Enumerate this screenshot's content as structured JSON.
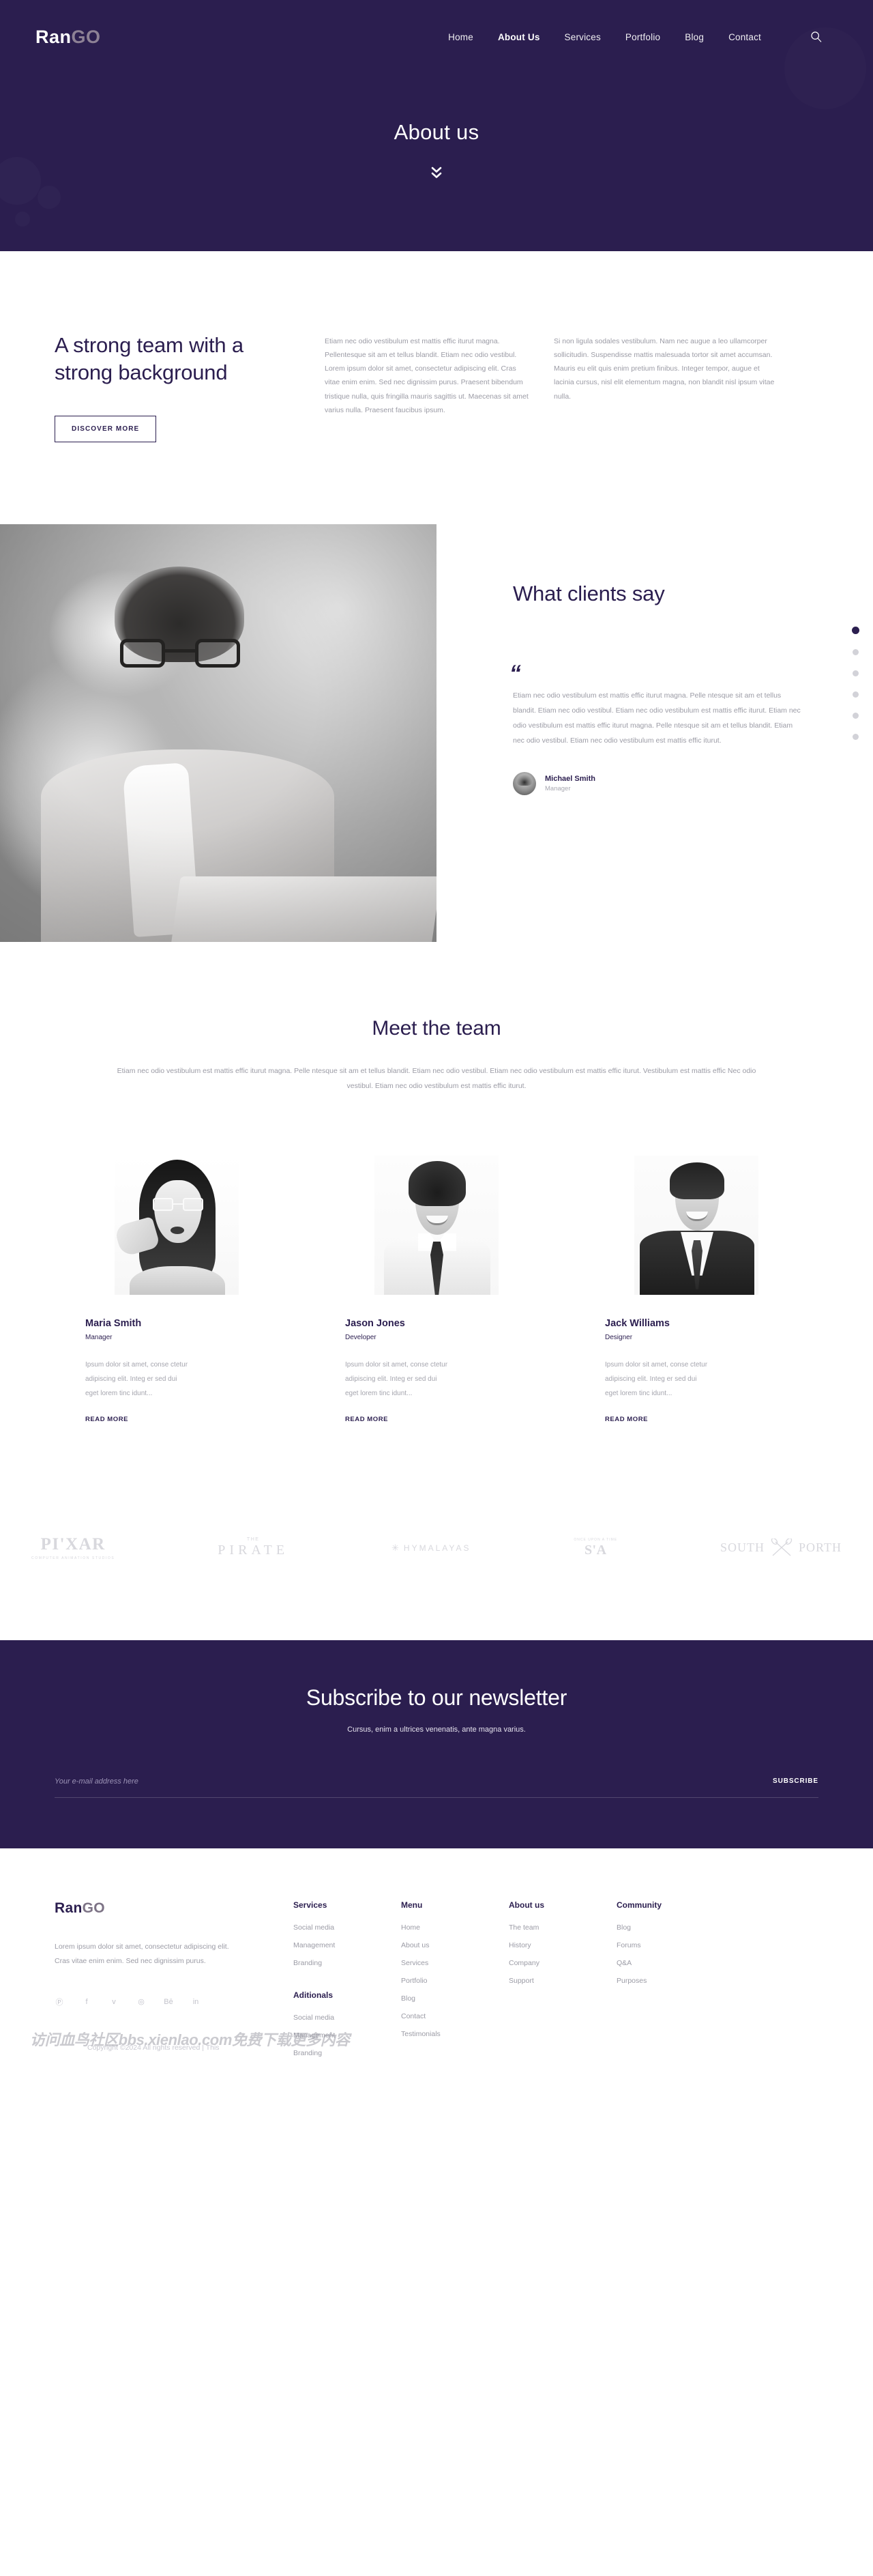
{
  "brand": {
    "part1": "Ran",
    "part2": "GO"
  },
  "nav": {
    "items": [
      {
        "label": "Home",
        "active": false
      },
      {
        "label": "About Us",
        "active": true
      },
      {
        "label": "Services",
        "active": false
      },
      {
        "label": "Portfolio",
        "active": false
      },
      {
        "label": "Blog",
        "active": false
      },
      {
        "label": "Contact",
        "active": false
      }
    ],
    "search_icon": "search-icon"
  },
  "hero": {
    "title": "About us",
    "scroll_icon": "chevron-double-down-icon"
  },
  "strong_team": {
    "heading": "A strong team with a strong background",
    "button": "DISCOVER MORE",
    "col1": "Etiam nec odio vestibulum est mattis effic iturut magna. Pellentesque sit am et tellus blandit. Etiam nec odio vestibul. Lorem ipsum dolor sit amet, consectetur adipiscing elit. Cras vitae enim enim. Sed nec dignissim purus. Praesent bibendum tristique nulla, quis fringilla mauris sagittis ut. Maecenas sit amet varius nulla. Praesent faucibus ipsum.",
    "col2": "Si non ligula sodales vestibulum. Nam nec augue a leo ullamcorper sollicitudin. Suspendisse mattis malesuada tortor sit amet accumsan. Mauris eu elit quis enim pretium finibus. Integer tempor, augue et lacinia cursus, nisl elit elementum magna, non blandit nisl ipsum vitae nulla."
  },
  "testimonials": {
    "title": "What clients say",
    "quote_mark": "”",
    "text": "Etiam nec odio vestibulum est mattis effic iturut magna. Pelle ntesque sit am et tellus blandit. Etiam nec odio vestibul. Etiam nec odio vestibulum est mattis effic iturut. Etiam nec odio vestibulum est mattis effic iturut magna. Pelle ntesque sit am et tellus blandit. Etiam nec odio vestibul. Etiam nec odio vestibulum est mattis effic iturut.",
    "author_name": "Michael Smith",
    "author_role": "Manager",
    "dots": 6,
    "active_dot": 0
  },
  "meet_team": {
    "title": "Meet the team",
    "subtitle": "Etiam nec odio vestibulum est mattis effic iturut magna. Pelle ntesque sit am et tellus blandit. Etiam nec odio vestibul. Etiam nec odio vestibulum est mattis effic iturut. Vestibulum est mattis effic Nec odio vestibul. Etiam nec odio vestibulum est mattis effic iturut.",
    "members": [
      {
        "name": "Maria Smith",
        "role": "Manager",
        "text": "Ipsum dolor sit amet, conse ctetur adipiscing elit. Integ er sed dui eget lorem tinc idunt...",
        "more": "READ MORE"
      },
      {
        "name": "Jason Jones",
        "role": "Developer",
        "text": "Ipsum dolor sit amet, conse ctetur adipiscing elit. Integ er sed dui eget lorem tinc idunt...",
        "more": "READ MORE"
      },
      {
        "name": "Jack Williams",
        "role": "Designer",
        "text": "Ipsum dolor sit amet, conse ctetur adipiscing elit. Integ er sed dui eget lorem tinc idunt...",
        "more": "READ MORE"
      }
    ]
  },
  "brands": [
    {
      "name": "PI'XAR",
      "sub": "COMPUTER ANIMATION STUDIOS"
    },
    {
      "top": "THE",
      "name": "PIRATE"
    },
    {
      "name": "HYMALAYAS"
    },
    {
      "top": "ONCE UPON A TIME",
      "name": "S'A"
    },
    {
      "name_left": "SOUTH",
      "name_right": "PORTH"
    }
  ],
  "newsletter": {
    "title": "Subscribe to our newsletter",
    "subtitle": "Cursus, enim a ultrices venenatis, ante magna varius.",
    "input_placeholder": "Your e-mail address here",
    "input_value": "",
    "submit": "SUBSCRIBE"
  },
  "footer": {
    "description": "Lorem ipsum dolor sit amet, consectetur adipiscing elit. Cras vitae enim enim. Sed nec dignissim purus.",
    "social": [
      "pinterest-icon",
      "facebook-icon",
      "twitter-icon",
      "dribbble-icon",
      "behance-icon",
      "linkedin-icon"
    ],
    "social_glyphs": [
      "Ⓟ",
      "f",
      "ᴠ",
      "◎",
      "Bē",
      "in"
    ],
    "columns": [
      {
        "title": "Services",
        "items": [
          "Social media",
          "Management",
          "Branding"
        ],
        "title2": "Aditionals",
        "items2": [
          "Social media",
          "Management",
          "Branding"
        ]
      },
      {
        "title": "Menu",
        "items": [
          "Home",
          "About us",
          "Services",
          "Portfolio",
          "Blog",
          "Contact",
          "Testimonials"
        ]
      },
      {
        "title": "About us",
        "items": [
          "The team",
          "History",
          "Company",
          "Support"
        ]
      },
      {
        "title": "Community",
        "items": [
          "Blog",
          "Forums",
          "Q&A",
          "Purposes"
        ]
      }
    ],
    "copyright": "Copyright ©2024 All rights reserved | This",
    "watermark": "访问血鸟社区bbs.xienlao.com免费下载更多内容"
  },
  "colors": {
    "brand_purple": "#2b1e4f",
    "muted_text": "#9b9ba5",
    "light_gray": "#d6d6dc"
  }
}
